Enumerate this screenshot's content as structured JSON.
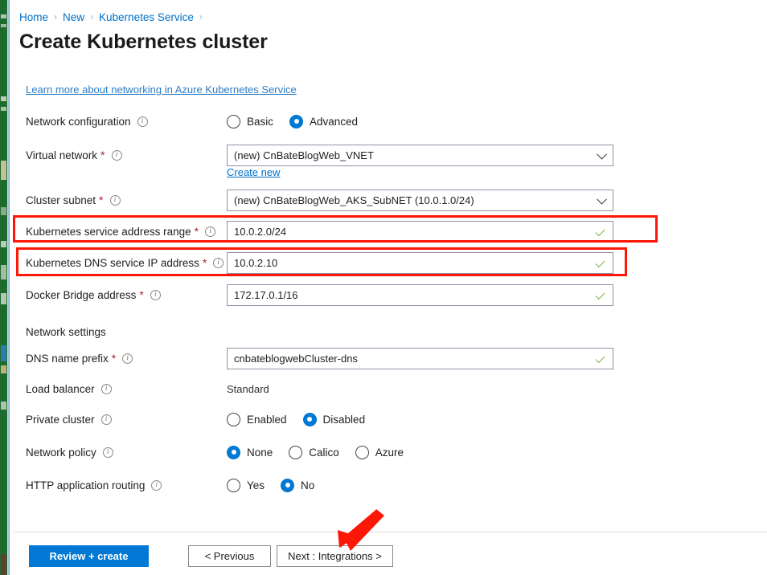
{
  "breadcrumb": {
    "items": [
      "Home",
      "New",
      "Kubernetes Service"
    ],
    "separator": "›"
  },
  "page_title": "Create Kubernetes cluster",
  "learn_more_link": "Learn more about networking in Azure Kubernetes Service",
  "sections": {
    "network_settings_heading": "Network settings"
  },
  "fields": {
    "network_configuration": {
      "label": "Network configuration",
      "options": [
        "Basic",
        "Advanced"
      ],
      "selected": "Advanced"
    },
    "virtual_network": {
      "label": "Virtual network",
      "required": "*",
      "value": "(new) CnBateBlogWeb_VNET",
      "create_new_link": "Create new"
    },
    "cluster_subnet": {
      "label": "Cluster subnet",
      "required": "*",
      "value": "(new) CnBateBlogWeb_AKS_SubNET (10.0.1.0/24)"
    },
    "service_address_range": {
      "label": "Kubernetes service address range",
      "required": "*",
      "value": "10.0.2.0/24"
    },
    "dns_service_ip": {
      "label": "Kubernetes DNS service IP address",
      "required": "*",
      "value": "10.0.2.10"
    },
    "docker_bridge_address": {
      "label": "Docker Bridge address",
      "required": "*",
      "value": "172.17.0.1/16"
    },
    "dns_name_prefix": {
      "label": "DNS name prefix",
      "required": "*",
      "value": "cnbateblogwebCluster-dns"
    },
    "load_balancer": {
      "label": "Load balancer",
      "value": "Standard"
    },
    "private_cluster": {
      "label": "Private cluster",
      "options": [
        "Enabled",
        "Disabled"
      ],
      "selected": "Disabled"
    },
    "network_policy": {
      "label": "Network policy",
      "options": [
        "None",
        "Calico",
        "Azure"
      ],
      "selected": "None"
    },
    "http_application_routing": {
      "label": "HTTP application routing",
      "options": [
        "Yes",
        "No"
      ],
      "selected": "No"
    }
  },
  "footer": {
    "review_create": "Review + create",
    "previous": "< Previous",
    "next": "Next : Integrations >"
  },
  "colors": {
    "accent_blue": "#0078d4",
    "link_blue": "#0070c9",
    "required_red": "#a4262c",
    "valid_green": "#7cb342",
    "annotation_red": "#fc1707",
    "field_border": "#9b8aa5"
  }
}
